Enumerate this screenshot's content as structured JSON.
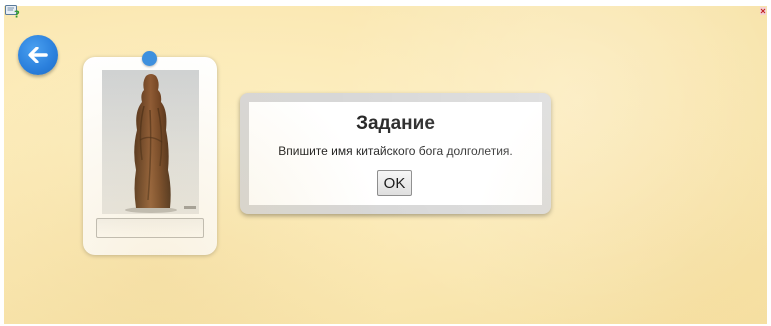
{
  "toolbar": {
    "help_icon": "help-question-icon",
    "close_icon": "close-icon"
  },
  "navigation": {
    "back_icon": "arrow-left-icon"
  },
  "card": {
    "image": "carved-wooden-figure-of-longevity-god",
    "answer_value": ""
  },
  "dialog": {
    "title": "Задание",
    "message": "Впишите имя китайского бога долголетия.",
    "ok_label": "OK"
  },
  "colors": {
    "background": "#fbe9b5",
    "accent_blue": "#2a7fdc",
    "dialog_frame": "#d7d7d7"
  }
}
